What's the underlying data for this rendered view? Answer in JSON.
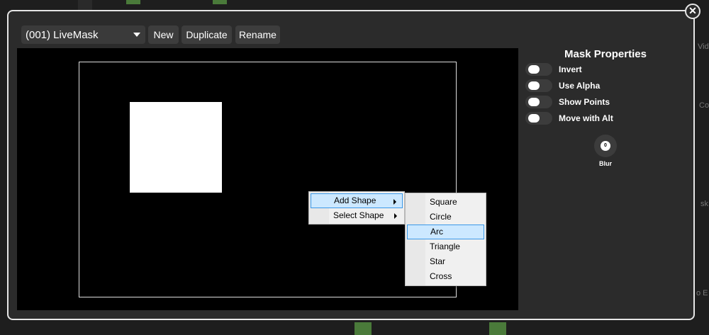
{
  "header": {
    "mask_select": "(001) LiveMask",
    "new_label": "New",
    "duplicate_label": "Duplicate",
    "rename_label": "Rename"
  },
  "context_menu": {
    "items": [
      {
        "label": "Add Shape",
        "selected": true
      },
      {
        "label": "Select Shape",
        "selected": false
      }
    ]
  },
  "submenu": {
    "items": [
      {
        "label": "Square",
        "selected": false
      },
      {
        "label": "Circle",
        "selected": false
      },
      {
        "label": "Arc",
        "selected": true
      },
      {
        "label": "Triangle",
        "selected": false
      },
      {
        "label": "Star",
        "selected": false
      },
      {
        "label": "Cross",
        "selected": false
      }
    ]
  },
  "properties": {
    "title": "Mask Properties",
    "toggles": [
      {
        "label": "Invert",
        "on": false
      },
      {
        "label": "Use Alpha",
        "on": false
      },
      {
        "label": "Show Points",
        "on": false
      },
      {
        "label": "Move with Alt",
        "on": false
      }
    ],
    "blur_value": "0",
    "blur_label": "Blur"
  },
  "close_glyph": "✕",
  "background_fragments": {
    "video": "Vide",
    "co": "Co",
    "sk": "sk",
    "eo": "o E"
  },
  "colors": {
    "modal_bg": "#2b2b2b",
    "canvas_bg": "#000000",
    "menu_highlight": "#cce8ff",
    "menu_highlight_border": "#3a98e8"
  }
}
